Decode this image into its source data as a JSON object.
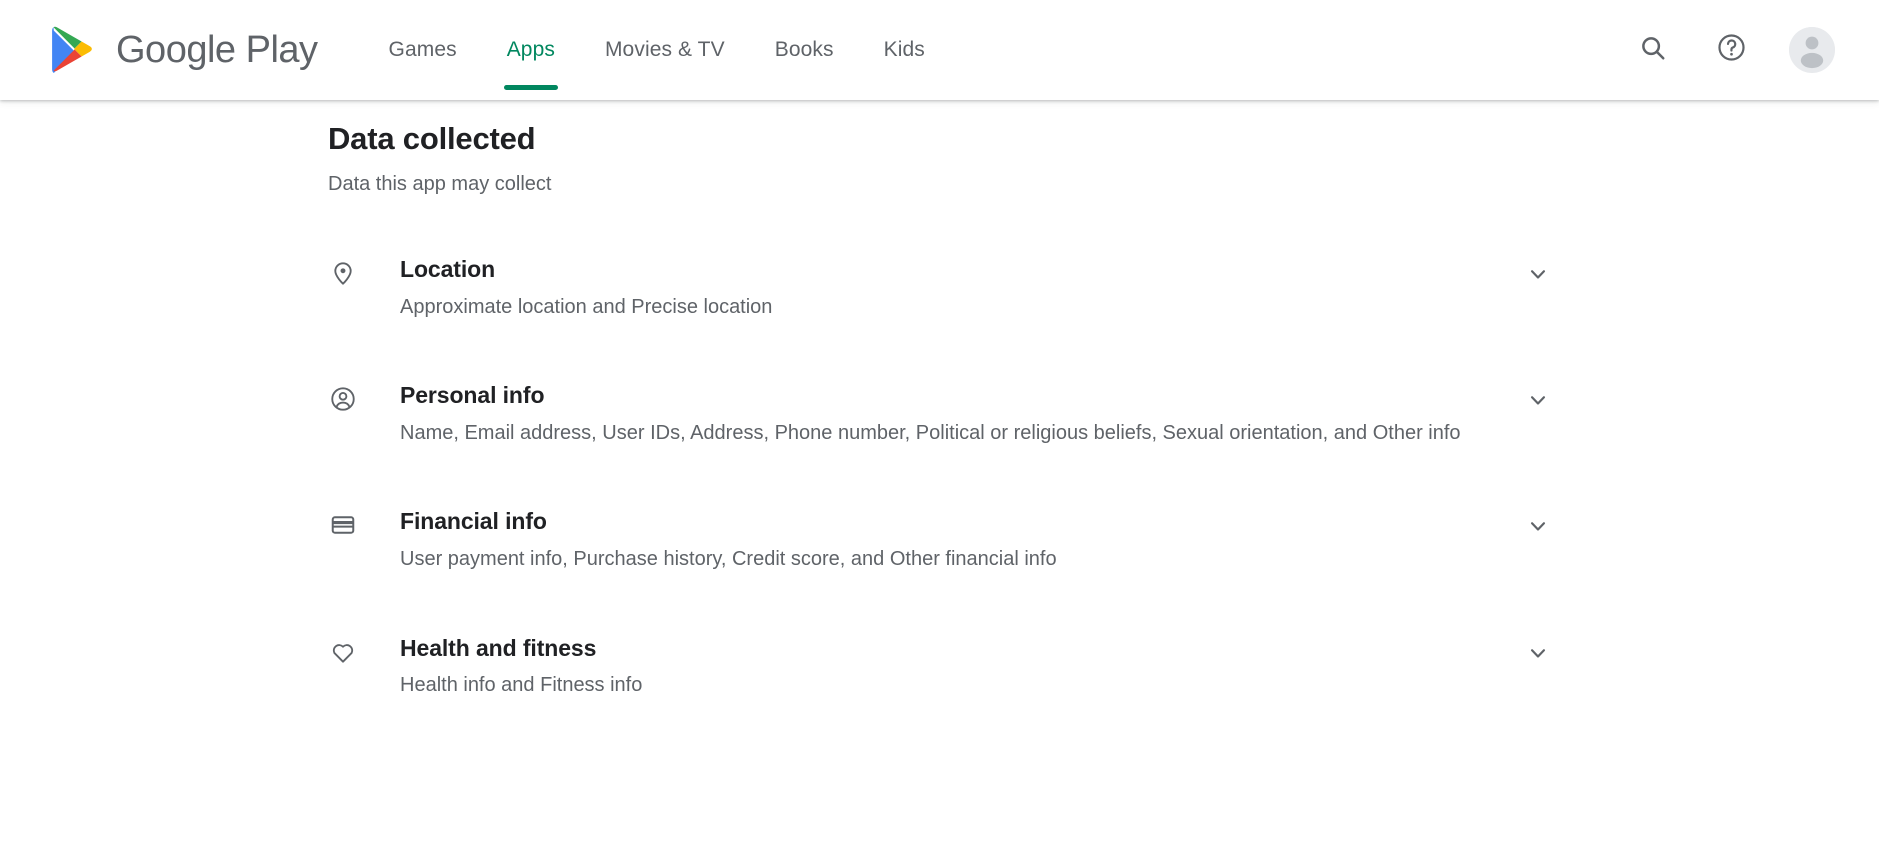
{
  "header": {
    "brand_name": "Google Play",
    "logo_icon": "google-play-logo",
    "nav_items": [
      {
        "label": "Games",
        "active": false
      },
      {
        "label": "Apps",
        "active": true
      },
      {
        "label": "Movies & TV",
        "active": false
      },
      {
        "label": "Books",
        "active": false
      },
      {
        "label": "Kids",
        "active": false
      }
    ],
    "actions": [
      {
        "icon": "search-icon",
        "name": "search-button"
      },
      {
        "icon": "help-circle-icon",
        "name": "help-button"
      },
      {
        "icon": "avatar-icon",
        "name": "account-avatar"
      }
    ],
    "accent_color": "#01875f",
    "text_color": "#5f6368"
  },
  "main": {
    "title": "Data collected",
    "subtitle": "Data this app may collect",
    "rows": [
      {
        "icon": "location-pin-icon",
        "title": "Location",
        "description": "Approximate location and Precise location",
        "chevron": "chevron-down-icon"
      },
      {
        "icon": "account-circle-icon",
        "title": "Personal info",
        "description": "Name, Email address, User IDs, Address, Phone number, Political or religious beliefs, Sexual orientation, and Other info",
        "chevron": "chevron-down-icon"
      },
      {
        "icon": "credit-card-icon",
        "title": "Financial info",
        "description": "User payment info, Purchase history, Credit score, and Other financial info",
        "chevron": "chevron-down-icon"
      },
      {
        "icon": "heart-outline-icon",
        "title": "Health and fitness",
        "description": "Health info and Fitness info",
        "chevron": "chevron-down-icon"
      }
    ]
  },
  "colors": {
    "title_text": "#202124",
    "body_text": "#5f6368",
    "background": "#ffffff",
    "play_green": "#01875f",
    "logo_blue": "#4285f4",
    "logo_green": "#34a853",
    "logo_yellow": "#fbbc04",
    "logo_red": "#ea4335"
  }
}
